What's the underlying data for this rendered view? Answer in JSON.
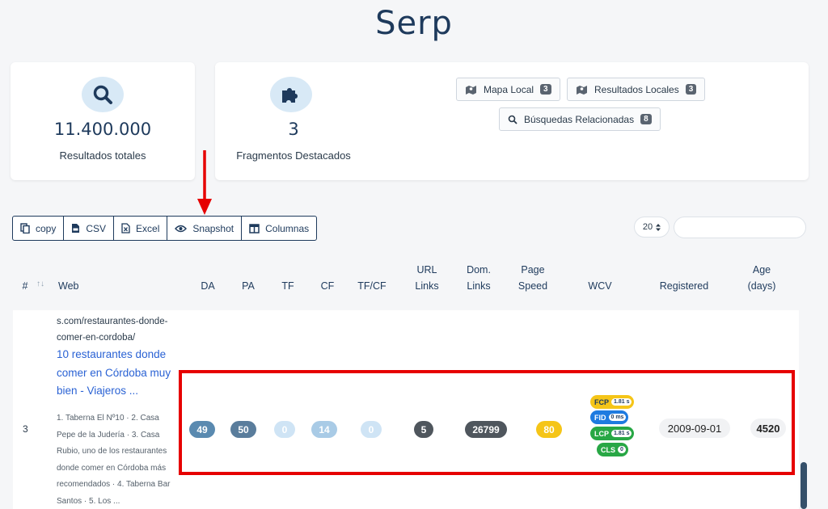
{
  "page_title": "Serp",
  "results_card": {
    "value": "11.400.000",
    "caption": "Resultados totales",
    "icon": "search-icon"
  },
  "features_card": {
    "value": "3",
    "caption": "Fragmentos Destacados",
    "icon": "puzzle-icon",
    "buttons": [
      {
        "label": "Mapa Local",
        "count": "3",
        "icon": "map-icon"
      },
      {
        "label": "Resultados Locales",
        "count": "3",
        "icon": "map-icon"
      },
      {
        "label": "Búsquedas Relacionadas",
        "count": "8",
        "icon": "search-icon"
      }
    ]
  },
  "toolbar": {
    "copy": "copy",
    "csv": "CSV",
    "excel": "Excel",
    "snapshot": "Snapshot",
    "columns": "Columnas"
  },
  "page_size": {
    "value": "20"
  },
  "table": {
    "headers": {
      "num": "#",
      "web": "Web",
      "da": "DA",
      "pa": "PA",
      "tf": "TF",
      "cf": "CF",
      "tfcf": "TF/CF",
      "url_links_1": "URL",
      "url_links_2": "Links",
      "dom_links_1": "Dom.",
      "dom_links_2": "Links",
      "page_speed_1": "Page",
      "page_speed_2": "Speed",
      "wcv": "WCV",
      "registered": "Registered",
      "age_1": "Age",
      "age_2": "(days)"
    },
    "row": {
      "num": "3",
      "url": "s.com/restaurantes-donde-comer-en-cordoba/",
      "title": "10 restaurantes donde comer en Córdoba muy bien - Viajeros ...",
      "snippet": "1. Taberna El Nº10 · 2. Casa Pepe de la Judería · 3. Casa Rubio, uno de los restaurantes donde comer en Córdoba más recomendados · 4. Taberna Bar Santos · 5. Los ...",
      "da": "49",
      "pa": "50",
      "tf": "0",
      "cf": "14",
      "tfcf": "0",
      "url_links": "5",
      "dom_links": "26799",
      "page_speed": "80",
      "wcv": {
        "fcp": {
          "label": "FCP",
          "value": "1.81 s"
        },
        "fid": {
          "label": "FID",
          "value": "0 ms"
        },
        "lcp": {
          "label": "LCP",
          "value": "1.81 s"
        },
        "cls": {
          "label": "CLS",
          "value": "0"
        }
      },
      "registered": "2009-09-01",
      "age": "4520"
    }
  },
  "colors": {
    "accent": "#1e3a5c",
    "highlight": "#e60000",
    "badge_da": "#5a8ab0",
    "badge_pa": "#5a7d9c",
    "badge_zero": "#cfe4f5",
    "badge_cf": "#a9cbe6",
    "badge_dark": "#4f565d",
    "badge_speed": "#f5c518",
    "wcv_fcp": "#f5c518",
    "wcv_fid": "#1e7be0",
    "wcv_good": "#28a745"
  }
}
